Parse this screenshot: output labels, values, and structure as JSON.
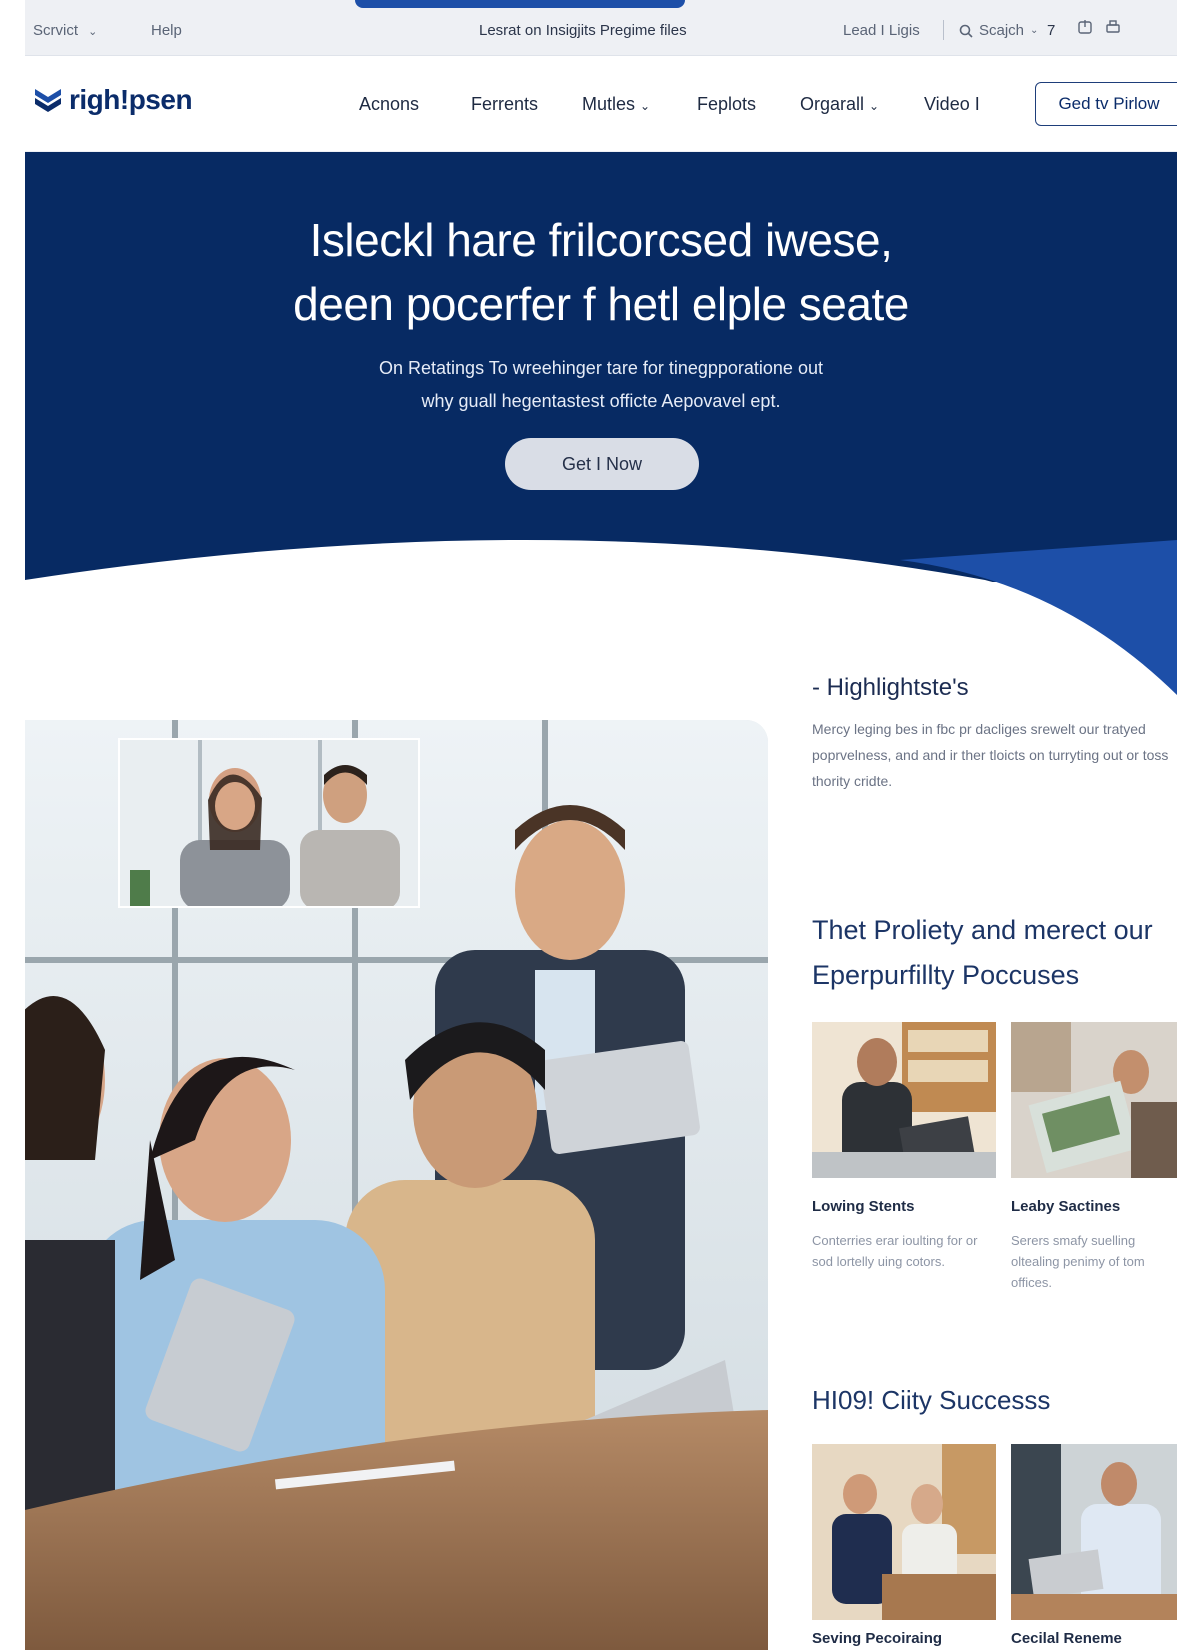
{
  "utility_bar": {
    "left_items": [
      "Scrvict",
      "Help"
    ],
    "center_text": "Lesrat on Insigjits Pregime files",
    "login": "Lead I Ligis",
    "search": "Scajch",
    "number": "7"
  },
  "nav": {
    "brand": "righ!psen",
    "links": [
      "Acnons",
      "Ferrents",
      "Mutles",
      "Feplots",
      "Orgarall",
      "Video I"
    ],
    "cta": "Ged tv Pirlow"
  },
  "hero": {
    "headline_1": "Isleckl hare frilcorcsed iwese,",
    "headline_2": "deen pocerfer f hetl elple seate",
    "sub_1": "On Retatings To wreehinger tare for tinegpporatione out",
    "sub_2": "why guall hegentastest officte Aepovavel ept.",
    "button": "Get I Now"
  },
  "highlights": {
    "title": "- Highlightste's",
    "text": "Mercy leging bes in fbc pr dacliges srewelt our tratyed poprvelness, and and ir ther tloicts on turryting out or toss thority cridte."
  },
  "priority": {
    "title_1": "Thet Proliety and merect our",
    "title_2": "Eperpurfillty Poccuses",
    "cards": [
      {
        "title": "Lowing Stents",
        "text": "Conterries erar ioulting for or sod lortelly uing cotors."
      },
      {
        "title": "Leaby Sactines",
        "text": "Serers smafy suelling oltealing penimy of tom offices."
      }
    ]
  },
  "success": {
    "title": "HI09! Ciity Successs",
    "cards": [
      {
        "title": "Seving Pecoiraing"
      },
      {
        "title": "Cecilal Reneme"
      }
    ]
  },
  "colors": {
    "brand_navy": "#072a63",
    "accent_blue": "#1d4fa8"
  }
}
